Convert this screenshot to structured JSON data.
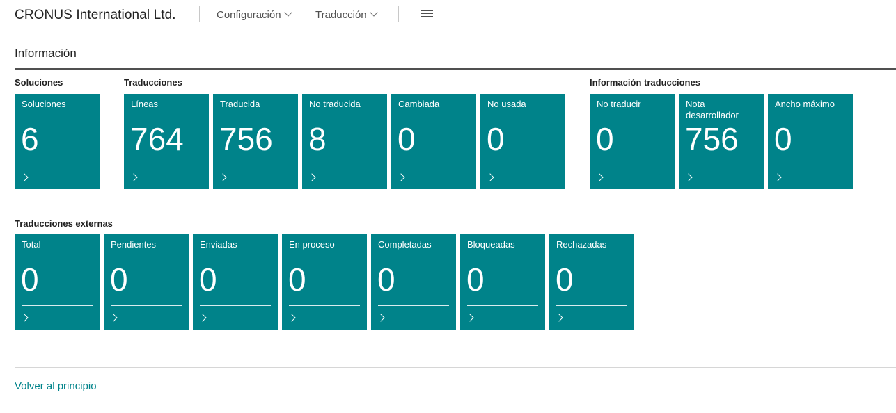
{
  "header": {
    "company": "CRONUS International Ltd.",
    "menu_config": "Configuración",
    "menu_translation": "Traducción"
  },
  "section": {
    "title": "Información"
  },
  "groups": {
    "solutions": {
      "label": "Soluciones",
      "tiles": [
        {
          "label": "Soluciones",
          "value": "6"
        }
      ]
    },
    "translations": {
      "label": "Traducciones",
      "tiles": [
        {
          "label": "Líneas",
          "value": "764"
        },
        {
          "label": "Traducida",
          "value": "756"
        },
        {
          "label": "No traducida",
          "value": "8"
        },
        {
          "label": "Cambiada",
          "value": "0"
        },
        {
          "label": "No usada",
          "value": "0"
        }
      ]
    },
    "translation_info": {
      "label": "Información traducciones",
      "tiles": [
        {
          "label": "No traducir",
          "value": "0"
        },
        {
          "label": "Nota desarrollador",
          "value": "756"
        },
        {
          "label": "Ancho máximo",
          "value": "0"
        }
      ]
    },
    "external": {
      "label": "Traducciones externas",
      "tiles": [
        {
          "label": "Total",
          "value": "0"
        },
        {
          "label": "Pendientes",
          "value": "0"
        },
        {
          "label": "Enviadas",
          "value": "0"
        },
        {
          "label": "En proceso",
          "value": "0"
        },
        {
          "label": "Completadas",
          "value": "0"
        },
        {
          "label": "Bloqueadas",
          "value": "0"
        },
        {
          "label": "Rechazadas",
          "value": "0"
        }
      ]
    }
  },
  "footer": {
    "back_to_top": "Volver al principio"
  },
  "colors": {
    "tile": "#00838a",
    "accent_link": "#00838a"
  }
}
